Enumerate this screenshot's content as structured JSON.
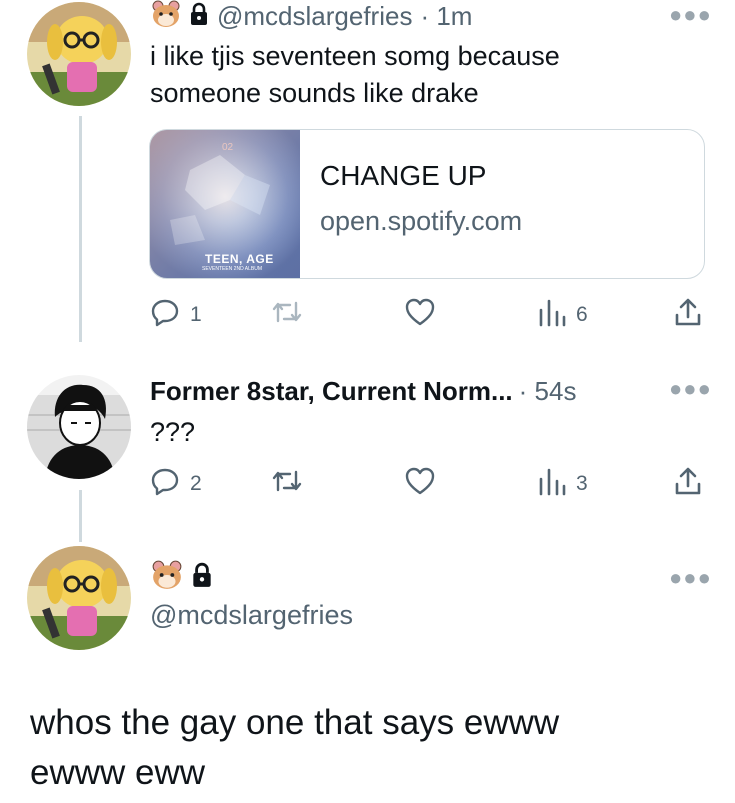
{
  "tweet1": {
    "handle": "@mcdslargefries",
    "time": "· 1m",
    "text_line1": "i like tjis seventeen somg because",
    "text_line2": "someone sounds like drake",
    "card": {
      "title": "CHANGE UP",
      "domain": "open.spotify.com",
      "album_num": "02",
      "album_title": "TEEN, AGE",
      "album_sub": "SEVENTEEN 2ND ALBUM"
    },
    "replies": "1",
    "retweets": "",
    "likes": "",
    "views": "6"
  },
  "tweet2": {
    "name": "Former 8star, Current Norm...",
    "time": "· 54s",
    "text": "???",
    "replies": "2",
    "retweets": "",
    "likes": "",
    "views": "3"
  },
  "tweet3": {
    "handle": "@mcdslargefries",
    "text_line1": "whos the gay one that says ewww",
    "text_line2": "ewww eww"
  },
  "colors": {
    "text": "#0f1419",
    "secondary": "#536471",
    "line": "#cfd9de",
    "card_bg": "#6e83b4"
  },
  "icons": [
    "hamster-emoji",
    "lock-icon",
    "more-icon",
    "reply-icon",
    "retweet-icon",
    "like-icon",
    "views-icon",
    "share-icon"
  ]
}
